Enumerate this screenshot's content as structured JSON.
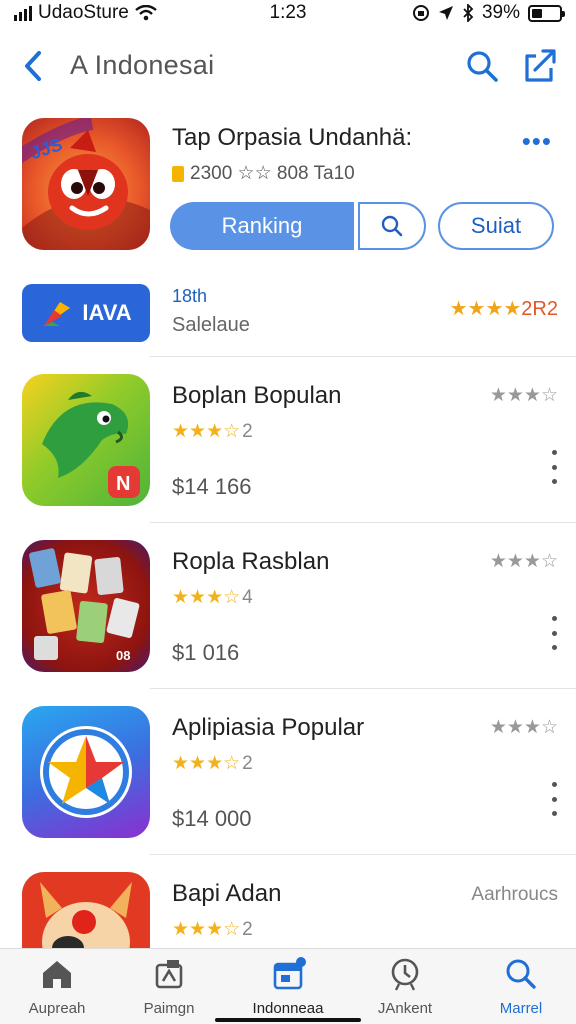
{
  "status_bar": {
    "carrier": "UdaoSture",
    "time": "1:23",
    "battery": "39%",
    "battery_level": 0.39
  },
  "nav": {
    "title": "A  Indonesai"
  },
  "featured": {
    "name": "Tap Orpasia Undanhä:",
    "meta": "2300 ☆☆ 808 Ta10",
    "primary_button": "Ranking",
    "secondary_button": "Suiat"
  },
  "banner": {
    "logo_text": "IAVA",
    "tag": "18th",
    "subtitle": "Salelaue",
    "rating_stars": "★★★★",
    "rating_value": "2R2"
  },
  "apps": [
    {
      "name": "Boplan Bopulan",
      "stars": "★★★☆",
      "count": "2",
      "price": "$14 166",
      "right_stars": "★★★☆"
    },
    {
      "name": "Ropla Rasblan",
      "stars": "★★★☆",
      "count": "4",
      "price": "$1 016",
      "right_stars": "★★★☆"
    },
    {
      "name": "Aplipiasia Popular",
      "stars": "★★★☆",
      "count": "2",
      "price": "$14 000",
      "right_stars": "★★★☆"
    },
    {
      "name": "Bapi Adan",
      "stars": "★★★☆",
      "count": "2",
      "right_text": "Aarhroucs"
    }
  ],
  "tabs": [
    {
      "label": "Aupreah",
      "icon": "home-icon"
    },
    {
      "label": "Paimgn",
      "icon": "apps-icon"
    },
    {
      "label": "Indonneaa",
      "icon": "calendar-icon"
    },
    {
      "label": "JAnkent",
      "icon": "ranking-icon"
    },
    {
      "label": "Marrel",
      "icon": "search-icon"
    }
  ],
  "colors": {
    "accent": "#1f6fd6",
    "button_fill": "#5a93e6",
    "star": "#f3b21b",
    "star_muted": "#999999"
  }
}
